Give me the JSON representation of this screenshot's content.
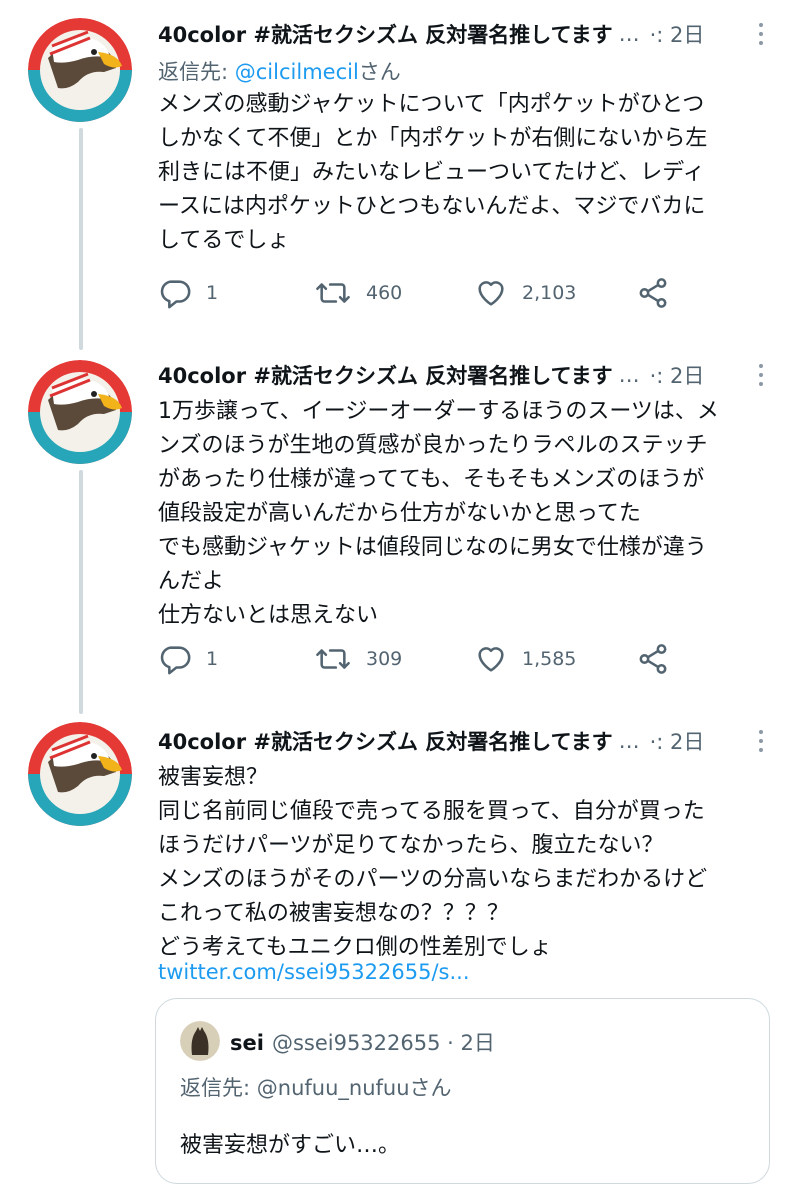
{
  "tweets": [
    {
      "author": "40color #就活セクシズム 反対署名推してます",
      "truncation": "…",
      "time": "·: 2日",
      "reply_label": "返信先: ",
      "reply_mention": "@cilcilmecil",
      "reply_suffix": "さん",
      "text": "メンズの感動ジャケットについて「内ポケットがひとつ\nしかなくて不便」とか「内ポケットが右側にないから左\n利きには不便」みたいなレビューついてたけど、レディ\nースには内ポケットひとつもないんだよ、マジでバカに\nしてるでしょ",
      "replies": "1",
      "retweets": "460",
      "likes": "2,103"
    },
    {
      "author": "40color #就活セクシズム 反対署名推してます",
      "truncation": "…",
      "time": "·: 2日",
      "text": "1万歩譲って、イージーオーダーするほうのスーツは、メ\nンズのほうが生地の質感が良かったりラペルのステッチ\nがあったり仕様が違ってても、そもそもメンズのほうが\n値段設定が高いんだから仕方がないかと思ってた\nでも感動ジャケットは値段同じなのに男女で仕様が違う\nんだよ\n仕方ないとは思えない",
      "replies": "1",
      "retweets": "309",
      "likes": "1,585"
    },
    {
      "author": "40color #就活セクシズム 反対署名推してます",
      "truncation": "…",
      "time": "·: 2日",
      "text": "被害妄想？\n同じ名前同じ値段で売ってる服を買って、自分が買った\nほうだけパーツが足りてなかったら、腹立たない？\nメンズのほうがそのパーツの分高いならまだわかるけど\nこれって私の被害妄想なの？？？？\nどう考えてもユニクロ側の性差別でしょ",
      "link": "twitter.com/ssei95322655/s..."
    }
  ],
  "quote": {
    "name": "sei",
    "handle_time": "@ssei95322655 · 2日",
    "reply_label": "返信先: ",
    "reply_mention": "@nufuu_nufuu",
    "reply_suffix": "さん",
    "text": "被害妄想がすごい…。"
  },
  "icons": [
    "reply-icon",
    "retweet-icon",
    "like-icon",
    "share-icon",
    "more-icon"
  ],
  "colors": {
    "accent": "#1d9bf0",
    "secondary_text": "#536471",
    "thread_line": "#cfd9de"
  }
}
